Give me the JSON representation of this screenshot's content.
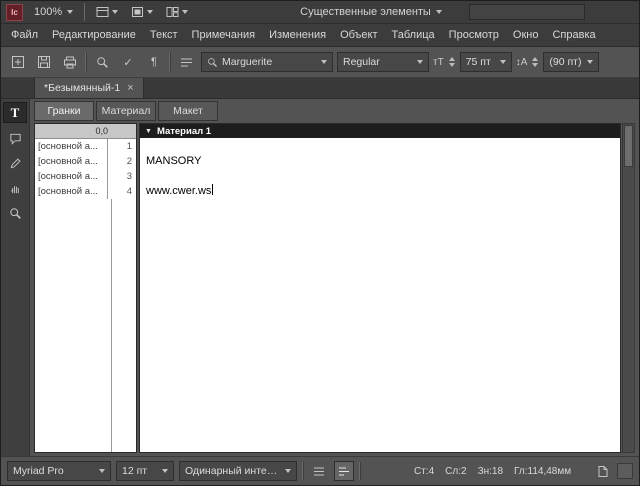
{
  "colors": {
    "chrome": "#535353",
    "bars": "#3c3c3c",
    "paper": "#ffffff",
    "story_header_bg": "#1d1d1d",
    "app_icon_bg": "#641f27"
  },
  "icons": {
    "app": "Ic",
    "pilcrow": "¶",
    "check": "✓",
    "type_tool": "T",
    "font_size_icon": "тT",
    "leading_icon": "↕A",
    "triangle_down": "▼"
  },
  "titlebar": {
    "zoom": "100%",
    "workspace": "Существенные элементы",
    "search_value": ""
  },
  "menus": [
    "Файл",
    "Редактирование",
    "Текст",
    "Примечания",
    "Изменения",
    "Объект",
    "Таблица",
    "Просмотр",
    "Окно",
    "Справка"
  ],
  "controlbar": {
    "font_family": "Marguerite",
    "font_style": "Regular",
    "font_size": "75 пт",
    "leading": "(90 пт)"
  },
  "doc_tab": {
    "title": "*Безымянный-1",
    "close": "×"
  },
  "view_tabs": [
    {
      "label": "Гранки",
      "active": true
    },
    {
      "label": "Материал",
      "active": false
    },
    {
      "label": "Макет",
      "active": false
    }
  ],
  "galley": {
    "ruler": "0,0",
    "story_header": "Материал 1",
    "rows": [
      {
        "style": "[основной а...",
        "line": "1",
        "text": ""
      },
      {
        "style": "[основной а...",
        "line": "2",
        "text": "MANSORY"
      },
      {
        "style": "[основной а...",
        "line": "3",
        "text": ""
      },
      {
        "style": "[основной а...",
        "line": "4",
        "text": "www.cwer.ws"
      }
    ]
  },
  "statusbar": {
    "font_family": "Myriad Pro",
    "font_size": "12 пт",
    "spacing": "Одинарный интервал",
    "stats": {
      "line": "Ст:4",
      "word": "Сл:2",
      "chars": "Зн:18",
      "depth": "Гл:114,48мм"
    }
  }
}
